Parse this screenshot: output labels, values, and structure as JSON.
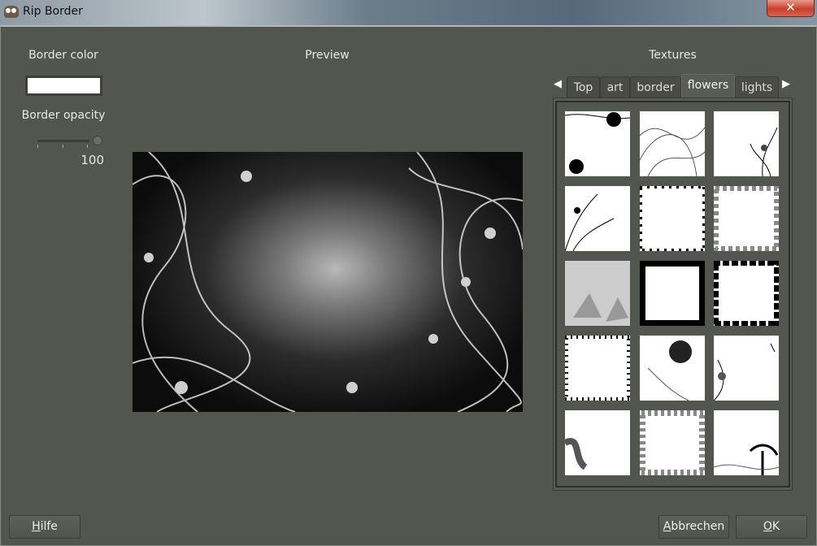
{
  "window": {
    "title": "Rip Border",
    "close_label": "✕"
  },
  "left": {
    "border_color_label": "Border color",
    "border_color": "#ffffff",
    "border_opacity_label": "Border opacity",
    "border_opacity_value": "100",
    "opacity_fraction": 1.0
  },
  "preview": {
    "label": "Preview"
  },
  "textures": {
    "label": "Textures",
    "tabs": [
      "Top",
      "art",
      "border",
      "flowers",
      "lights"
    ],
    "active_tab": "flowers",
    "thumbnail_count": 15
  },
  "buttons": {
    "help": "Hilfe",
    "cancel": "Abbrechen",
    "ok": "OK"
  }
}
